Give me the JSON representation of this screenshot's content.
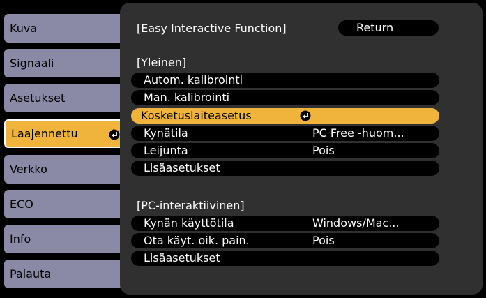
{
  "sidebar": {
    "items": [
      {
        "label": "Kuva"
      },
      {
        "label": "Signaali"
      },
      {
        "label": "Asetukset"
      },
      {
        "label": "Laajennettu",
        "active": true
      },
      {
        "label": "Verkko"
      },
      {
        "label": "ECO"
      },
      {
        "label": "Info"
      },
      {
        "label": "Palauta"
      }
    ]
  },
  "panel": {
    "header": "[Easy Interactive Function]",
    "return_label": "Return",
    "general_section": "[Yleinen]",
    "general_items": [
      {
        "label": "Autom. kalibrointi",
        "value": ""
      },
      {
        "label": "Man. kalibrointi",
        "value": ""
      },
      {
        "label": "Kosketuslaiteasetus",
        "value": "",
        "selected": true
      },
      {
        "label": "Kynätila",
        "value": "PC Free -huom..."
      },
      {
        "label": "Leijunta",
        "value": "Pois"
      },
      {
        "label": "Lisäasetukset",
        "value": ""
      }
    ],
    "pc_section": "[PC-interaktiivinen]",
    "pc_items": [
      {
        "label": "Kynän käyttötila",
        "value": "Windows/Mac..."
      },
      {
        "label": "Ota käyt. oik. pain.",
        "value": "Pois"
      },
      {
        "label": "Lisäasetukset",
        "value": ""
      }
    ]
  },
  "colors": {
    "tab": "#8a8aa6",
    "active": "#f0b43c",
    "panel": "#303030"
  }
}
